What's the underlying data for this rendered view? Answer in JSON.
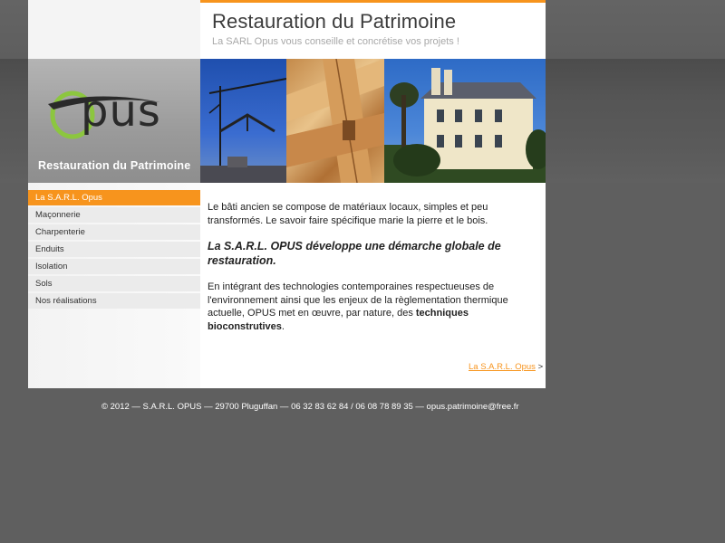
{
  "header": {
    "title": "Restauration du Patrimoine",
    "subtitle": "La SARL Opus vous conseille et concrétise vos projets !"
  },
  "logo": {
    "name": "Opus",
    "caption": "Restauration du Patrimoine"
  },
  "nav": {
    "items": [
      {
        "label": "La S.A.R.L. Opus",
        "active": true
      },
      {
        "label": "Maçonnerie",
        "active": false
      },
      {
        "label": "Charpenterie",
        "active": false
      },
      {
        "label": "Enduits",
        "active": false
      },
      {
        "label": "Isolation",
        "active": false
      },
      {
        "label": "Sols",
        "active": false
      },
      {
        "label": "Nos réalisations",
        "active": false
      }
    ]
  },
  "content": {
    "paragraph1": "Le bâti ancien se compose de matériaux locaux, simples et peu transformés. Le savoir faire spécifique marie la pierre et le bois.",
    "lead": "La S.A.R.L. OPUS développe une démarche globale de restauration.",
    "paragraph2_start": "En intégrant des technologies contemporaines respectueuses de l'environnement ainsi que les enjeux de la règlementation thermique actuelle, OPUS met en œuvre, par nature, des ",
    "paragraph2_bold": "techniques bioconstrutives",
    "paragraph2_end": ".",
    "more_link": "La S.A.R.L. Opus",
    "more_arrow": ">"
  },
  "footer": {
    "text": "© 2012 — S.A.R.L. OPUS — 29700 Pluguffan — 06 32 83 62 84 / 06 08 78 89 35 — opus.patrimoine@free.fr"
  },
  "colors": {
    "accent": "#f7941d",
    "background": "#5f5f5f",
    "page": "#ffffff"
  },
  "icons": [
    "logo-ring-icon",
    "crane-photo",
    "timber-beam-photo",
    "manor-house-photo"
  ]
}
